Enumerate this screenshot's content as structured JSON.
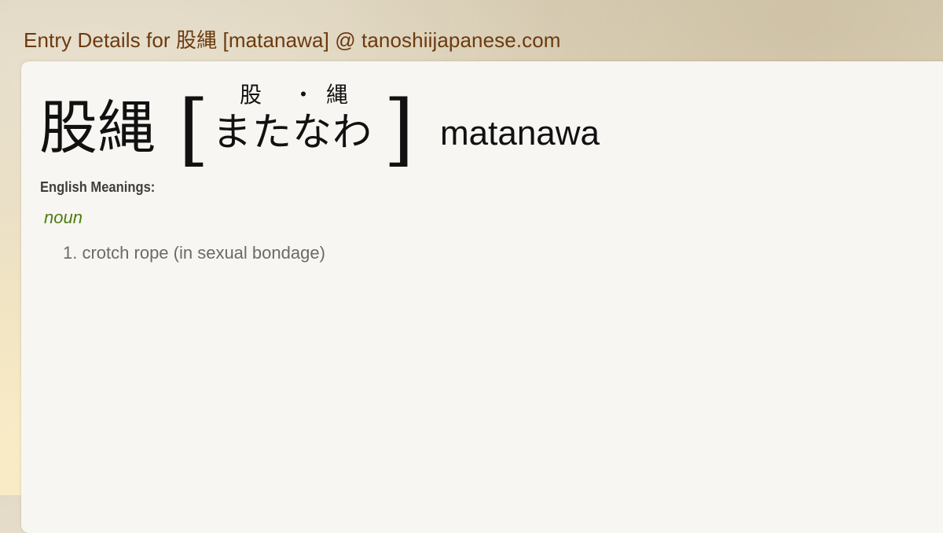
{
  "page": {
    "title": "Entry Details for 股縄 [matanawa] @ tanoshiijapanese.com"
  },
  "entry": {
    "kanji": "股縄",
    "bracket_open": "[",
    "bracket_close": "]",
    "furigana": [
      "股",
      "・",
      "縄"
    ],
    "reading_kana": "またなわ",
    "romaji": "matanawa"
  },
  "meanings": {
    "label": "English Meanings:",
    "part_of_speech": "noun",
    "definitions": [
      {
        "number": "1.",
        "text": "crotch rope (in sexual bondage)"
      }
    ]
  },
  "colors": {
    "title": "#6b3a10",
    "part_of_speech": "#4d7c10",
    "definition": "#6a6a6a",
    "card_background": "#f7f6f2"
  }
}
